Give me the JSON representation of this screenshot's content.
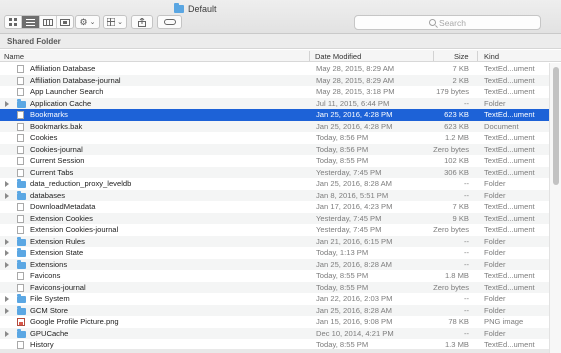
{
  "window": {
    "title": "Default"
  },
  "toolbar": {
    "view_icons": [
      "icon-view-icon",
      "list-view-icon",
      "column-view-icon",
      "cover-flow-icon"
    ],
    "action_icon": "gear-icon",
    "arrange_icon": "arrange-icon",
    "share_icon": "share-icon",
    "tag_icon": "tag-icon",
    "dropdown_glyph": "⌄"
  },
  "search": {
    "placeholder": "Search"
  },
  "pathbar": {
    "label": "Shared Folder"
  },
  "columns": {
    "name": "Name",
    "date": "Date Modified",
    "size": "Size",
    "kind": "Kind"
  },
  "files": [
    {
      "name": "Affiliation Database",
      "date": "May 28, 2015, 8:29 AM",
      "size": "7 KB",
      "kind": "TextEd...ument",
      "type": "doc"
    },
    {
      "name": "Affiliation Database-journal",
      "date": "May 28, 2015, 8:29 AM",
      "size": "2 KB",
      "kind": "TextEd...ument",
      "type": "doc"
    },
    {
      "name": "App Launcher Search",
      "date": "May 28, 2015, 3:18 PM",
      "size": "179 bytes",
      "kind": "TextEd...ument",
      "type": "doc"
    },
    {
      "name": "Application Cache",
      "date": "Jul 11, 2015, 6:44 PM",
      "size": "--",
      "kind": "Folder",
      "type": "folder"
    },
    {
      "name": "Bookmarks",
      "date": "Jan 25, 2016, 4:28 PM",
      "size": "623 KB",
      "kind": "TextEd...ument",
      "type": "doc",
      "selected": true
    },
    {
      "name": "Bookmarks.bak",
      "date": "Jan 25, 2016, 4:28 PM",
      "size": "623 KB",
      "kind": "Document",
      "type": "doc"
    },
    {
      "name": "Cookies",
      "date": "Today, 8:56 PM",
      "size": "1.2 MB",
      "kind": "TextEd...ument",
      "type": "doc"
    },
    {
      "name": "Cookies-journal",
      "date": "Today, 8:56 PM",
      "size": "Zero bytes",
      "kind": "TextEd...ument",
      "type": "doc"
    },
    {
      "name": "Current Session",
      "date": "Today, 8:55 PM",
      "size": "102 KB",
      "kind": "TextEd...ument",
      "type": "doc"
    },
    {
      "name": "Current Tabs",
      "date": "Yesterday, 7:45 PM",
      "size": "306 KB",
      "kind": "TextEd...ument",
      "type": "doc"
    },
    {
      "name": "data_reduction_proxy_leveldb",
      "date": "Jan 25, 2016, 8:28 AM",
      "size": "--",
      "kind": "Folder",
      "type": "folder"
    },
    {
      "name": "databases",
      "date": "Jan 8, 2016, 5:51 PM",
      "size": "--",
      "kind": "Folder",
      "type": "folder"
    },
    {
      "name": "DownloadMetadata",
      "date": "Jan 17, 2016, 4:23 PM",
      "size": "7 KB",
      "kind": "TextEd...ument",
      "type": "doc"
    },
    {
      "name": "Extension Cookies",
      "date": "Yesterday, 7:45 PM",
      "size": "9 KB",
      "kind": "TextEd...ument",
      "type": "doc"
    },
    {
      "name": "Extension Cookies-journal",
      "date": "Yesterday, 7:45 PM",
      "size": "Zero bytes",
      "kind": "TextEd...ument",
      "type": "doc"
    },
    {
      "name": "Extension Rules",
      "date": "Jan 21, 2016, 6:15 PM",
      "size": "--",
      "kind": "Folder",
      "type": "folder"
    },
    {
      "name": "Extension State",
      "date": "Today, 1:13 PM",
      "size": "--",
      "kind": "Folder",
      "type": "folder"
    },
    {
      "name": "Extensions",
      "date": "Jan 25, 2016, 8:28 AM",
      "size": "--",
      "kind": "Folder",
      "type": "folder"
    },
    {
      "name": "Favicons",
      "date": "Today, 8:55 PM",
      "size": "1.8 MB",
      "kind": "TextEd...ument",
      "type": "doc"
    },
    {
      "name": "Favicons-journal",
      "date": "Today, 8:55 PM",
      "size": "Zero bytes",
      "kind": "TextEd...ument",
      "type": "doc"
    },
    {
      "name": "File System",
      "date": "Jan 22, 2016, 2:03 PM",
      "size": "--",
      "kind": "Folder",
      "type": "folder"
    },
    {
      "name": "GCM Store",
      "date": "Jan 25, 2016, 8:28 AM",
      "size": "--",
      "kind": "Folder",
      "type": "folder"
    },
    {
      "name": "Google Profile Picture.png",
      "date": "Jan 15, 2016, 9:08 PM",
      "size": "78 KB",
      "kind": "PNG image",
      "type": "image"
    },
    {
      "name": "GPUCache",
      "date": "Dec 10, 2014, 4:21 PM",
      "size": "--",
      "kind": "Folder",
      "type": "folder"
    },
    {
      "name": "History",
      "date": "Today, 8:55 PM",
      "size": "1.3 MB",
      "kind": "TextEd...ument",
      "type": "doc"
    }
  ],
  "colors": {
    "selection": "#1d62d7",
    "folder": "#5ba7e3",
    "stripe": "#f4f5f5"
  }
}
